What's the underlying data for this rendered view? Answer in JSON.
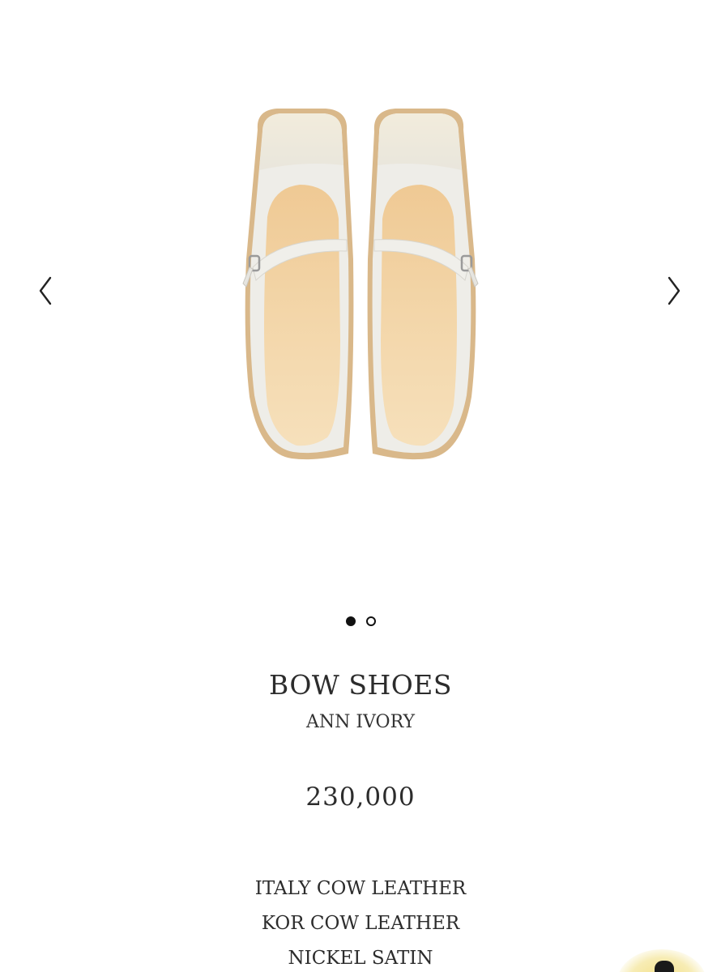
{
  "gallery": {
    "image_alt": "ivory mary jane flats top view",
    "prev_icon": "chevron-left-icon",
    "next_icon": "chevron-right-icon",
    "total_slides": 2,
    "active_slide": 1
  },
  "product": {
    "title": "BOW SHOES",
    "color": "ANN IVORY",
    "price": "230,000",
    "materials": [
      "ITALY COW LEATHER",
      "KOR COW LEATHER",
      "NICKEL SATIN"
    ]
  },
  "colors": {
    "leather": "#ecebe6",
    "insole": "#f1d4a7",
    "sole": "#dcb98c",
    "text": "#2c2c2c",
    "badge": "#f4dd7a"
  }
}
